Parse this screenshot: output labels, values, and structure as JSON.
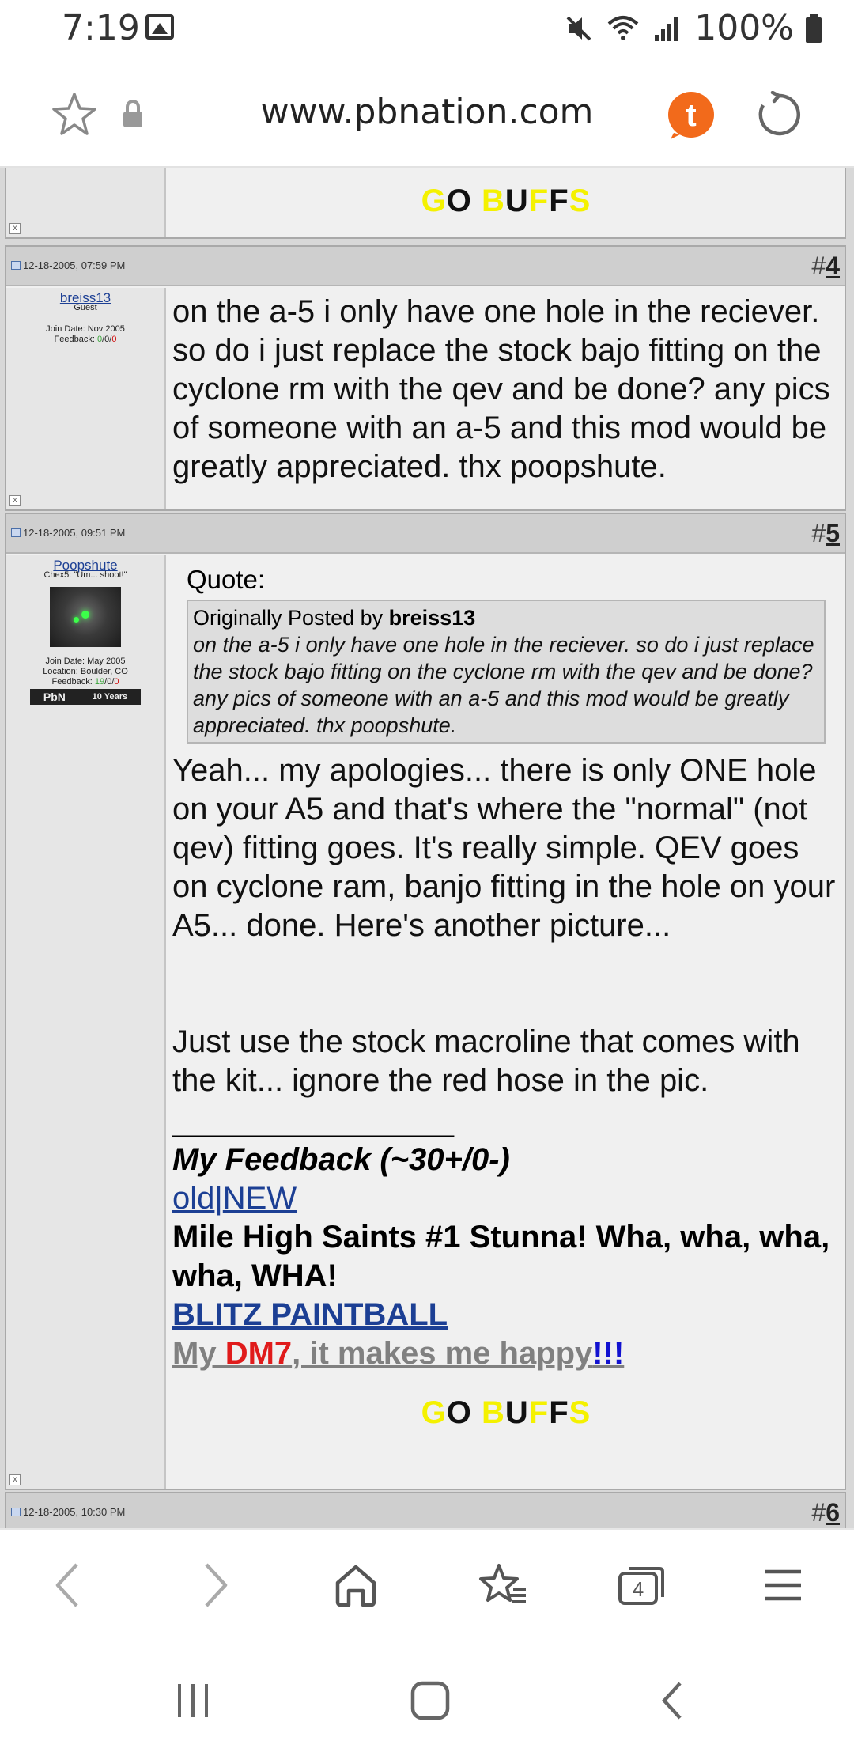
{
  "status": {
    "time": "7:19",
    "battery_text": "100%"
  },
  "browser": {
    "url": "www.pbnation.com",
    "tabs_count": "4"
  },
  "posts": [
    {
      "id": "prev",
      "signature": {
        "go_buffs": [
          "G",
          "O",
          " ",
          "B",
          "U",
          "F",
          "F",
          "S"
        ]
      }
    },
    {
      "id": "post4",
      "date": "12-18-2005, 07:59 PM",
      "number_prefix": "#",
      "number": "4",
      "username": "breiss13",
      "user_title": "Guest",
      "join_date": "Join Date: Nov 2005",
      "feedback_label": "Feedback:",
      "feedback_pos": "0",
      "feedback_neu": "0",
      "feedback_neg": "0",
      "body": "on the a-5 i only have one hole in the reciever. so do i just replace the stock bajo fitting on the cyclone rm with the qev and be done? any pics of someone with an a-5 and this mod would be greatly appreciated. thx poopshute."
    },
    {
      "id": "post5",
      "date": "12-18-2005, 09:51 PM",
      "number_prefix": "#",
      "number": "5",
      "username": "Poopshute",
      "user_title": "Chex5: \"Um... shoot!\"",
      "join_date": "Join Date: May 2005",
      "location": "Location: Boulder, CO",
      "feedback_label": "Feedback:",
      "feedback_pos": "19",
      "feedback_neu": "0",
      "feedback_neg": "0",
      "badge_text": "PbN",
      "badge_years": "10 Years",
      "quote_label": "Quote:",
      "quote_prefix": "Originally Posted by",
      "quote_author": "breiss13",
      "quote_text": "on the a-5 i only have one hole in the reciever. so do i just replace the stock bajo fitting on the cyclone rm with the qev and be done? any pics of someone with an a-5 and this mod would be greatly appreciated. thx poopshute.",
      "body1": "Yeah... my apologies... there is only ONE hole on your A5 and that's where the \"normal\" (not qev) fitting goes. It's really simple. QEV goes on cyclone ram, banjo fitting in the hole on your A5... done. Here's another picture...",
      "body2": "Just use the stock macroline that comes with the kit... ignore the red hose in the pic.",
      "sig_rule": "________________",
      "sig_feedback": "My Feedback (~30+/0-)",
      "sig_old": "old",
      "sig_sep": "|",
      "sig_new": "NEW",
      "sig_saints": "Mile High Saints #1 Stunna! Wha, wha, wha, wha, WHA!",
      "sig_blitz": "BLITZ PAINTBALL",
      "sig_my": "My ",
      "sig_dm7": "DM7",
      "sig_happy": ", it makes me happy",
      "sig_excl": "!!!",
      "go_buffs": [
        "G",
        "O",
        " ",
        "B",
        "U",
        "F",
        "F",
        "S"
      ]
    },
    {
      "id": "post6",
      "date": "12-18-2005, 10:30 PM",
      "number_prefix": "#",
      "number": "6"
    }
  ],
  "colors": {
    "go_buffs_yellow": "#f4f100",
    "link_blue": "#1c3f94",
    "feedback_green": "#3aa53a",
    "feedback_red": "#d01010",
    "dm7_red": "#e01b1b",
    "happy_gray": "#808080",
    "excl_blue": "#1212d0",
    "toolbar_t_orange": "#f26a1b"
  }
}
